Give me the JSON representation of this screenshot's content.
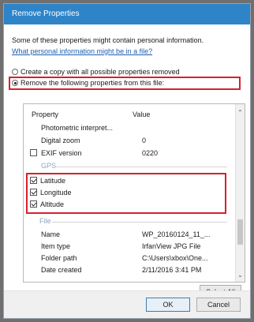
{
  "dialog": {
    "title": "Remove Properties",
    "info_text": "Some of these properties might contain personal information.",
    "info_link": "What personal information might be in a file?",
    "option_copy": "Create a copy with all possible properties removed",
    "option_remove": "Remove the following properties from this file:"
  },
  "list": {
    "header_property": "Property",
    "header_value": "Value",
    "rows": [
      {
        "name": "Photometric interpret...",
        "value": ""
      },
      {
        "name": "Digital zoom",
        "value": "0"
      },
      {
        "name": "EXIF version",
        "value": "0220"
      }
    ],
    "gps_group": "GPS",
    "gps_items": [
      "Latitude",
      "Longitude",
      "Altitude"
    ],
    "file_group": "File",
    "file_rows": [
      {
        "name": "Name",
        "value": "WP_20160124_11_..."
      },
      {
        "name": "Item type",
        "value": "IrfanView JPG File"
      },
      {
        "name": "Folder path",
        "value": "C:\\Users\\xbox\\One..."
      },
      {
        "name": "Date created",
        "value": "2/11/2016 3:41 PM"
      }
    ]
  },
  "buttons": {
    "select_all": "Select All",
    "ok": "OK",
    "cancel": "Cancel"
  }
}
